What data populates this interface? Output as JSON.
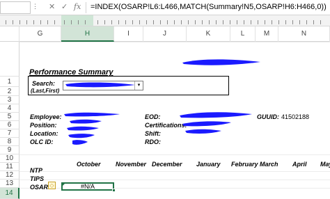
{
  "formula_bar": {
    "name_box": "",
    "cancel_glyph": "✕",
    "enter_glyph": "✓",
    "fx_glyph": "fx",
    "formula": "=INDEX(OSARP!L6:L466,MATCH(Summary!N5,OSARP!H6:H466,0))"
  },
  "columns": [
    "G",
    "H",
    "I",
    "J",
    "K",
    "L",
    "M",
    "N"
  ],
  "selected_column": "H",
  "rows": [
    "1",
    "2",
    "3",
    "4",
    "5",
    "6",
    "7",
    "8",
    "9",
    "10",
    "11",
    "12",
    "13",
    "14"
  ],
  "selected_row": "14",
  "summary": {
    "title": "Performance Summary",
    "search_label": "Search:",
    "search_hint": "(Last,First)",
    "search_value": "",
    "dropdown_arrow": "▾",
    "employee_label": "Employee:",
    "position_label": "Position:",
    "location_label": "Location:",
    "olc_label": "OLC ID:",
    "eod_label": "EOD:",
    "certifications_label": "Certifications:",
    "shift_label": "Shift:",
    "rdo_label": "RDO:",
    "guuid_label": "GUUID:",
    "guuid_value": "41502188"
  },
  "months": [
    "October",
    "November",
    "December",
    "January",
    "February",
    "March",
    "April",
    "May"
  ],
  "metrics": [
    "NTP",
    "TIPS",
    "OSARP"
  ],
  "active_cell": {
    "value": "#N/A"
  },
  "warning_glyph": "◇",
  "colors": {
    "selection": "#217346",
    "redaction": "#1a1aff"
  }
}
